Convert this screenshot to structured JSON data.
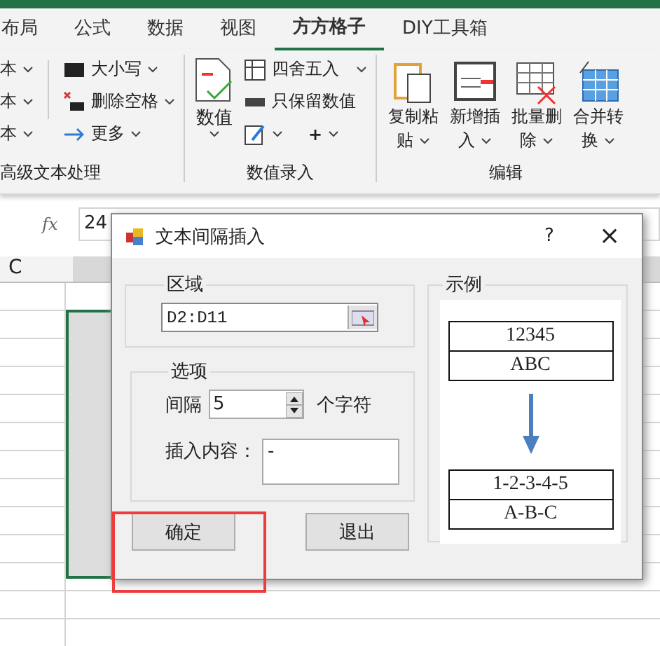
{
  "tabs": [
    {
      "label": "布局",
      "selected": false
    },
    {
      "label": "公式",
      "selected": false
    },
    {
      "label": "数据",
      "selected": false
    },
    {
      "label": "视图",
      "selected": false
    },
    {
      "label": "方方格子",
      "selected": true
    },
    {
      "label": "DIY工具箱",
      "selected": false
    }
  ],
  "ribbon": {
    "groups": [
      {
        "label": "高级文本处理",
        "cut_items": [
          "本",
          "本",
          "本"
        ],
        "items": [
          {
            "label": "大小写"
          },
          {
            "label": "删除空格"
          },
          {
            "label": "更多"
          }
        ]
      },
      {
        "label": "数值录入",
        "big": {
          "label": "数值"
        },
        "items": [
          {
            "label": "四舍五入",
            "dropdown": true
          },
          {
            "label": "只保留数值",
            "dropdown": false
          }
        ],
        "plus": "+"
      },
      {
        "label": "编辑",
        "buttons": [
          {
            "lines": [
              "复制粘",
              "贴"
            ]
          },
          {
            "lines": [
              "新增插",
              "入"
            ]
          },
          {
            "lines": [
              "批量删",
              "除"
            ]
          },
          {
            "lines": [
              "合并转",
              "换"
            ]
          }
        ]
      }
    ]
  },
  "formula_bar": {
    "fx": "fx",
    "value": "24"
  },
  "sheet": {
    "column": "C"
  },
  "dialog": {
    "title": "文本间隔插入",
    "help": "?",
    "close": "×",
    "range": {
      "legend": "区域",
      "value": "D2:D11"
    },
    "options": {
      "legend": "选项",
      "interval_label": "间隔",
      "interval_value": "5",
      "unit": "个字符",
      "insert_label": "插入内容：",
      "insert_value": "-"
    },
    "example": {
      "legend": "示例",
      "before": [
        "12345",
        "ABC"
      ],
      "after": [
        "1-2-3-4-5",
        "A-B-C"
      ]
    },
    "buttons": [
      {
        "label": "确定",
        "highlighted": true
      },
      {
        "label": "退出",
        "highlighted": false
      }
    ]
  }
}
